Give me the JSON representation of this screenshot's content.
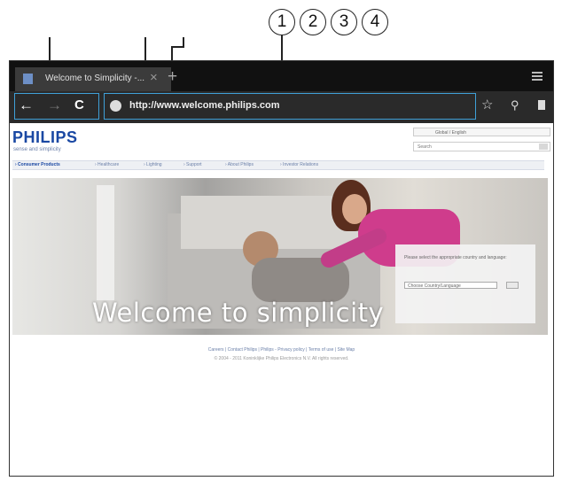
{
  "callouts": [
    "1",
    "2",
    "3",
    "4"
  ],
  "browser": {
    "tab_title": "Welcome to Simplicity -...",
    "tab_close": "×",
    "new_tab": "+",
    "back": "←",
    "forward": "→",
    "reload": "C",
    "url": "http://www.welcome.philips.com",
    "icons": [
      "star-icon",
      "search-icon",
      "bookmarks-icon",
      "menu-icon",
      "globe-icon"
    ]
  },
  "site": {
    "logo": "PHILIPS",
    "tagline": "sense and simplicity",
    "language_selector": "Global / English",
    "search_placeholder": "Search",
    "nav": [
      "› Consumer Products",
      "› Healthcare",
      "› Lighting",
      "› Support",
      "› About Philips",
      "› Investor Relations"
    ],
    "hero_text": "Welcome to simplicity",
    "panel_text": "Please select the appropriate country and language:",
    "panel_select": "Choose Country/Language",
    "footer_links": "Careers | Contact Philips | Philips - Privacy policy | Terms of use | Site Map",
    "footer_copyright": "© 2004 - 2011 Koninklijke Philips Electronics N.V. All rights reserved."
  },
  "colors": {
    "accent": "#3fa0d8",
    "brand": "#1a48a3",
    "tabbar": "#111111"
  }
}
